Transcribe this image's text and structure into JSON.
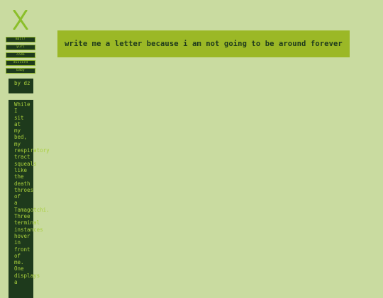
{
  "brand": {
    "logo_icon": "x-logo-icon",
    "color": "#8bbf2a"
  },
  "nav": {
    "items": [
      {
        "label": "mail!"
      },
      {
        "label": "yuri"
      },
      {
        "label": "code"
      },
      {
        "label": "discord"
      },
      {
        "label": "baby"
      }
    ]
  },
  "byline": {
    "text": "by dz"
  },
  "story": {
    "text": "While I sit at my bed, my respiratory tract squeals like the death throes of a Tamagotchi. Three terminal instances hover in front of me. One displays a"
  },
  "banner": {
    "title": "write me a letter because i am not going to be around forever"
  },
  "colors": {
    "background": "#c9dba0",
    "panel": "#1e3a1c",
    "accent": "#9bb826",
    "text_light": "#a8cf3c"
  }
}
